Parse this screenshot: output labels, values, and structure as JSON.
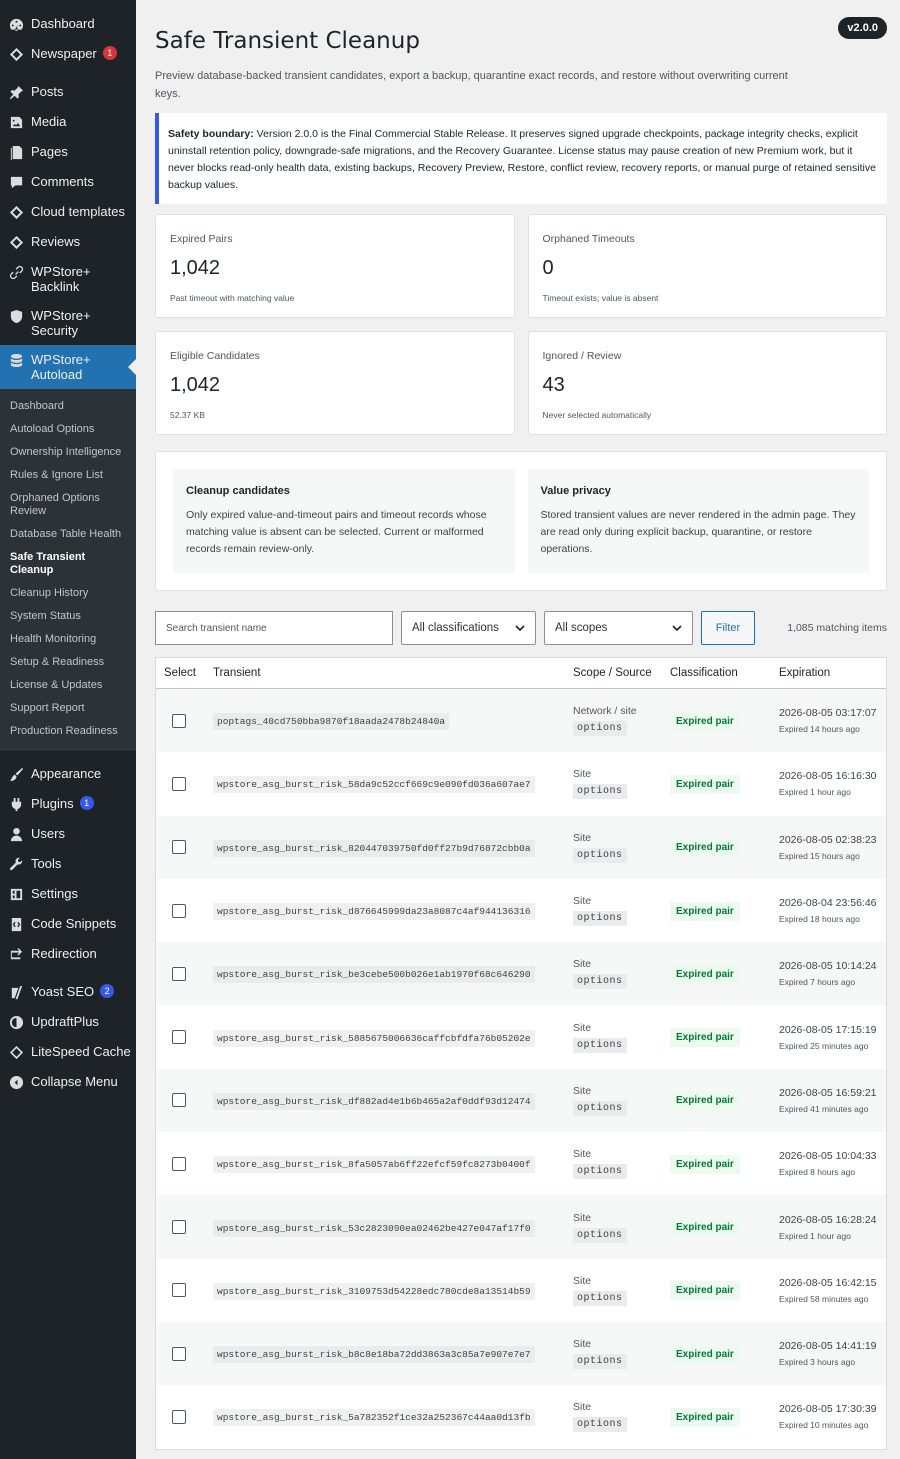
{
  "sidebar": {
    "top_items": [
      {
        "label": "Dashboard",
        "icon": "dashboard-icon"
      },
      {
        "label": "Newspaper",
        "icon": "newspaper-icon",
        "badge": "1"
      }
    ],
    "content_items": [
      {
        "label": "Posts",
        "icon": "pin-icon"
      },
      {
        "label": "Media",
        "icon": "media-icon"
      },
      {
        "label": "Pages",
        "icon": "pages-icon"
      },
      {
        "label": "Comments",
        "icon": "comment-icon"
      },
      {
        "label": "Cloud templates",
        "icon": "diamond-icon"
      },
      {
        "label": "Reviews",
        "icon": "diamond-icon"
      },
      {
        "label": "WPStore+ Backlink",
        "icon": "link-icon"
      },
      {
        "label": "WPStore+ Security",
        "icon": "shield-icon"
      }
    ],
    "active_item": {
      "label": "WPStore+ Autoload",
      "icon": "database-icon"
    },
    "submenu": [
      "Dashboard",
      "Autoload Options",
      "Ownership Intelligence",
      "Rules & Ignore List",
      "Orphaned Options Review",
      "Database Table Health",
      "Safe Transient Cleanup",
      "Cleanup History",
      "System Status",
      "Health Monitoring",
      "Setup & Readiness",
      "License & Updates",
      "Support Report",
      "Production Readiness"
    ],
    "submenu_current": "Safe Transient Cleanup",
    "bottom_items": [
      {
        "label": "Appearance",
        "icon": "brush-icon"
      },
      {
        "label": "Plugins",
        "icon": "plugin-icon",
        "badge": "1"
      },
      {
        "label": "Users",
        "icon": "user-icon"
      },
      {
        "label": "Tools",
        "icon": "wrench-icon"
      },
      {
        "label": "Settings",
        "icon": "settings-icon"
      },
      {
        "label": "Code Snippets",
        "icon": "code-icon"
      },
      {
        "label": "Redirection",
        "icon": "redirect-icon"
      }
    ],
    "plugin_items": [
      {
        "label": "Yoast SEO",
        "icon": "yoast-icon",
        "badge": "2"
      },
      {
        "label": "UpdraftPlus",
        "icon": "updraft-icon"
      },
      {
        "label": "LiteSpeed Cache",
        "icon": "litespeed-icon"
      },
      {
        "label": "Collapse Menu",
        "icon": "collapse-icon"
      }
    ]
  },
  "header": {
    "version": "v2.0.0",
    "title": "Safe Transient Cleanup",
    "lead": "Preview database-backed transient candidates, export a backup, quarantine exact records, and restore without overwriting current keys."
  },
  "notice": {
    "strong": "Safety boundary:",
    "text": " Version 2.0.0 is the Final Commercial Stable Release. It preserves signed upgrade checkpoints, package integrity checks, explicit uninstall retention policy, downgrade-safe migrations, and the Recovery Guarantee. License status may pause creation of new Premium work, but it never blocks read-only health data, existing backups, Recovery Preview, Restore, conflict review, recovery reports, or manual purge of retained sensitive backup values."
  },
  "cards": [
    {
      "label": "Expired Pairs",
      "value": "1,042",
      "note": "Past timeout with matching value"
    },
    {
      "label": "Orphaned Timeouts",
      "value": "0",
      "note": "Timeout exists; value is absent"
    },
    {
      "label": "Eligible Candidates",
      "value": "1,042",
      "note": "52.37 KB"
    },
    {
      "label": "Ignored / Review",
      "value": "43",
      "note": "Never selected automatically"
    }
  ],
  "info": [
    {
      "title": "Cleanup candidates",
      "text": "Only expired value-and-timeout pairs and timeout records whose matching value is absent can be selected. Current or malformed records remain review-only."
    },
    {
      "title": "Value privacy",
      "text": "Stored transient values are never rendered in the admin page. They are read only during explicit backup, quarantine, or restore operations."
    }
  ],
  "filters": {
    "search_placeholder": "Search transient name",
    "classification": "All classifications",
    "scope": "All scopes",
    "filter_label": "Filter",
    "count": "1,085 matching items"
  },
  "table": {
    "headers": [
      "Select",
      "Transient",
      "Scope / Source",
      "Classification",
      "Expiration"
    ],
    "rows": [
      {
        "name": "poptags_40cd750bba9870f18aada2478b24840a",
        "scope": "Network / site",
        "source": "options",
        "cls": "Expired pair",
        "date": "2026-08-05 03:17:07",
        "rel": "Expired 14 hours ago"
      },
      {
        "name": "wpstore_asg_burst_risk_58da9c52ccf669c9e090fd036a607ae7",
        "scope": "Site",
        "source": "options",
        "cls": "Expired pair",
        "date": "2026-08-05 16:16:30",
        "rel": "Expired 1 hour ago"
      },
      {
        "name": "wpstore_asg_burst_risk_820447039750fd0ff27b9d76872cbb0a",
        "scope": "Site",
        "source": "options",
        "cls": "Expired pair",
        "date": "2026-08-05 02:38:23",
        "rel": "Expired 15 hours ago"
      },
      {
        "name": "wpstore_asg_burst_risk_d876645999da23a8087c4af944136316",
        "scope": "Site",
        "source": "options",
        "cls": "Expired pair",
        "date": "2026-08-04 23:56:46",
        "rel": "Expired 18 hours ago"
      },
      {
        "name": "wpstore_asg_burst_risk_be3cebe500b026e1ab1970f68c646290",
        "scope": "Site",
        "source": "options",
        "cls": "Expired pair",
        "date": "2026-08-05 10:14:24",
        "rel": "Expired 7 hours ago"
      },
      {
        "name": "wpstore_asg_burst_risk_5885675006636caffcbfdfa76b05202e",
        "scope": "Site",
        "source": "options",
        "cls": "Expired pair",
        "date": "2026-08-05 17:15:19",
        "rel": "Expired 25 minutes ago"
      },
      {
        "name": "wpstore_asg_burst_risk_df882ad4e1b6b465a2af0ddf93d12474",
        "scope": "Site",
        "source": "options",
        "cls": "Expired pair",
        "date": "2026-08-05 16:59:21",
        "rel": "Expired 41 minutes ago"
      },
      {
        "name": "wpstore_asg_burst_risk_8fa5057ab6ff22efcf59fc8273b0400f",
        "scope": "Site",
        "source": "options",
        "cls": "Expired pair",
        "date": "2026-08-05 10:04:33",
        "rel": "Expired 8 hours ago"
      },
      {
        "name": "wpstore_asg_burst_risk_53c2823090ea02462be427e047af17f0",
        "scope": "Site",
        "source": "options",
        "cls": "Expired pair",
        "date": "2026-08-05 16:28:24",
        "rel": "Expired 1 hour ago"
      },
      {
        "name": "wpstore_asg_burst_risk_3109753d54228edc780cde8a13514b59",
        "scope": "Site",
        "source": "options",
        "cls": "Expired pair",
        "date": "2026-08-05 16:42:15",
        "rel": "Expired 58 minutes ago"
      },
      {
        "name": "wpstore_asg_burst_risk_b8c8e18ba72dd3863a3c85a7e907e7e7",
        "scope": "Site",
        "source": "options",
        "cls": "Expired pair",
        "date": "2026-08-05 14:41:19",
        "rel": "Expired 3 hours ago"
      },
      {
        "name": "wpstore_asg_burst_risk_5a782352f1ce32a252367c44aa0d13fb",
        "scope": "Site",
        "source": "options",
        "cls": "Expired pair",
        "date": "2026-08-05 17:30:39",
        "rel": "Expired 10 minutes ago"
      }
    ]
  },
  "colors": {
    "accent": "#2271b1",
    "notice_border": "#3858e9",
    "sidebar": "#1d2327",
    "expired": "#007a34"
  }
}
